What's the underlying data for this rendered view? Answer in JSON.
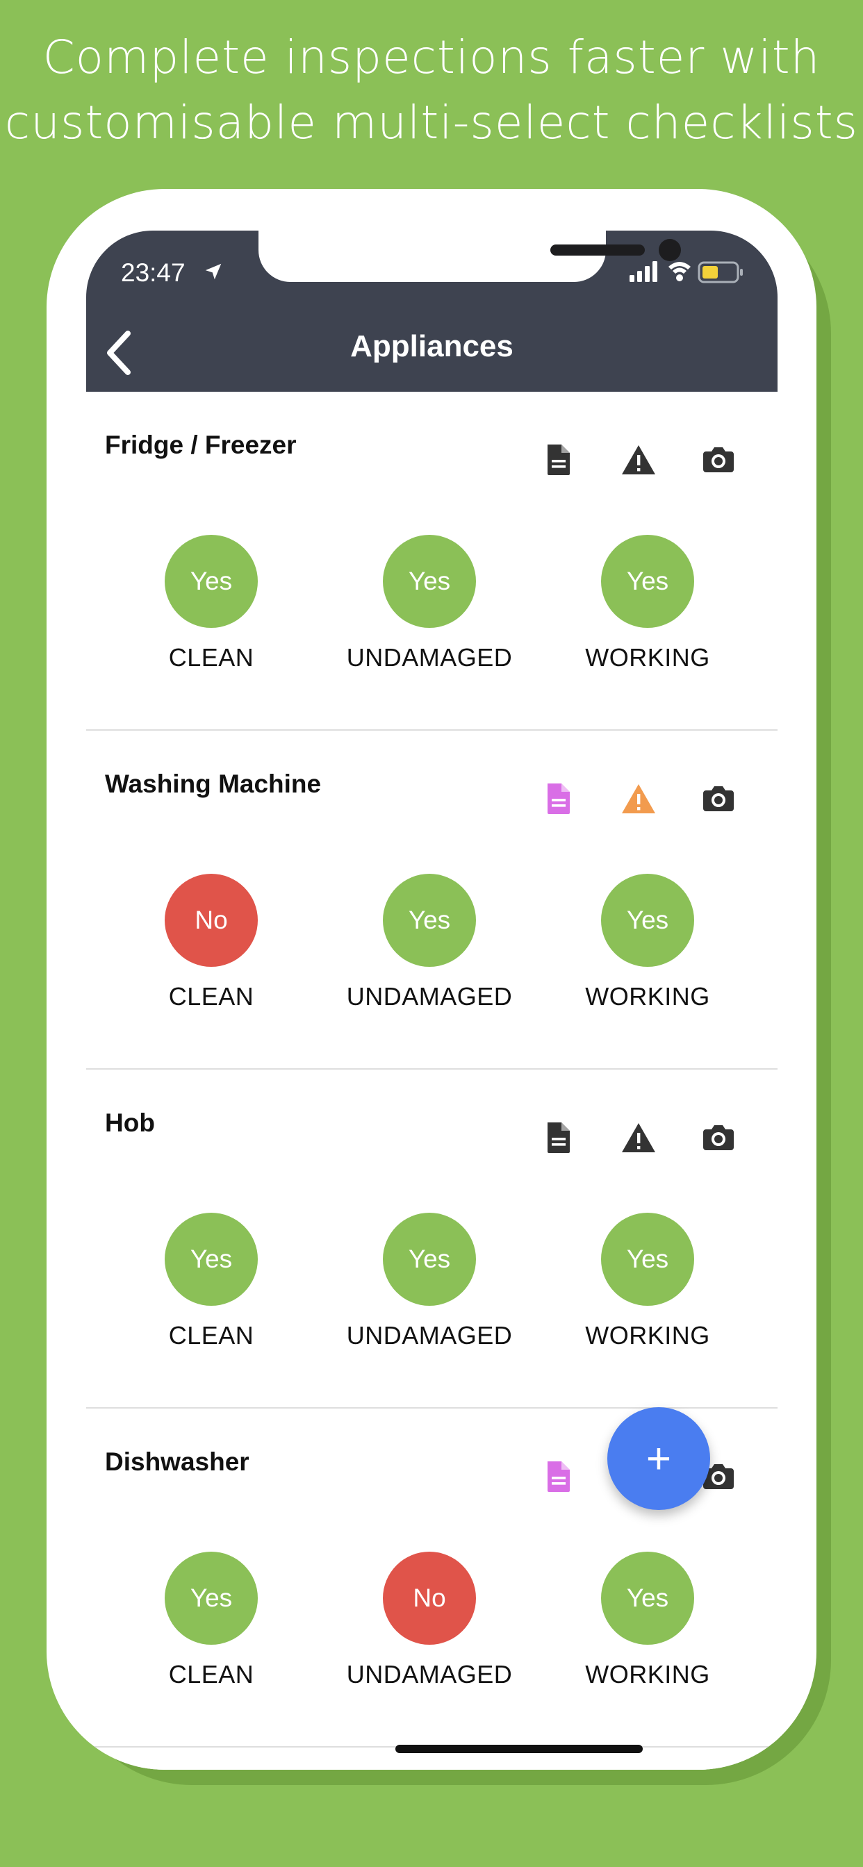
{
  "headline": {
    "line1": "Complete inspections faster with",
    "line2": "customisable multi-select checklists"
  },
  "status_bar": {
    "time": "23:47"
  },
  "nav": {
    "title": "Appliances"
  },
  "colors": {
    "yes": "#8bc057",
    "no": "#e0544a",
    "note_active": "#d96ee6",
    "warn_active": "#f29b4e",
    "inactive": "#333333",
    "fab": "#4a7df0"
  },
  "items": [
    {
      "title": "Fridge / Freezer",
      "note_active": false,
      "warn_active": false,
      "checks": [
        {
          "value": "Yes",
          "state": "yes",
          "label": "CLEAN"
        },
        {
          "value": "Yes",
          "state": "yes",
          "label": "UNDAMAGED"
        },
        {
          "value": "Yes",
          "state": "yes",
          "label": "WORKING"
        }
      ]
    },
    {
      "title": "Washing Machine",
      "note_active": true,
      "warn_active": true,
      "checks": [
        {
          "value": "No",
          "state": "no",
          "label": "CLEAN"
        },
        {
          "value": "Yes",
          "state": "yes",
          "label": "UNDAMAGED"
        },
        {
          "value": "Yes",
          "state": "yes",
          "label": "WORKING"
        }
      ]
    },
    {
      "title": "Hob",
      "note_active": false,
      "warn_active": false,
      "checks": [
        {
          "value": "Yes",
          "state": "yes",
          "label": "CLEAN"
        },
        {
          "value": "Yes",
          "state": "yes",
          "label": "UNDAMAGED"
        },
        {
          "value": "Yes",
          "state": "yes",
          "label": "WORKING"
        }
      ]
    },
    {
      "title": "Dishwasher",
      "note_active": true,
      "warn_active": true,
      "checks": [
        {
          "value": "Yes",
          "state": "yes",
          "label": "CLEAN"
        },
        {
          "value": "No",
          "state": "no",
          "label": "UNDAMAGED"
        },
        {
          "value": "Yes",
          "state": "yes",
          "label": "WORKING"
        }
      ]
    }
  ],
  "fab": {
    "label": "+"
  }
}
